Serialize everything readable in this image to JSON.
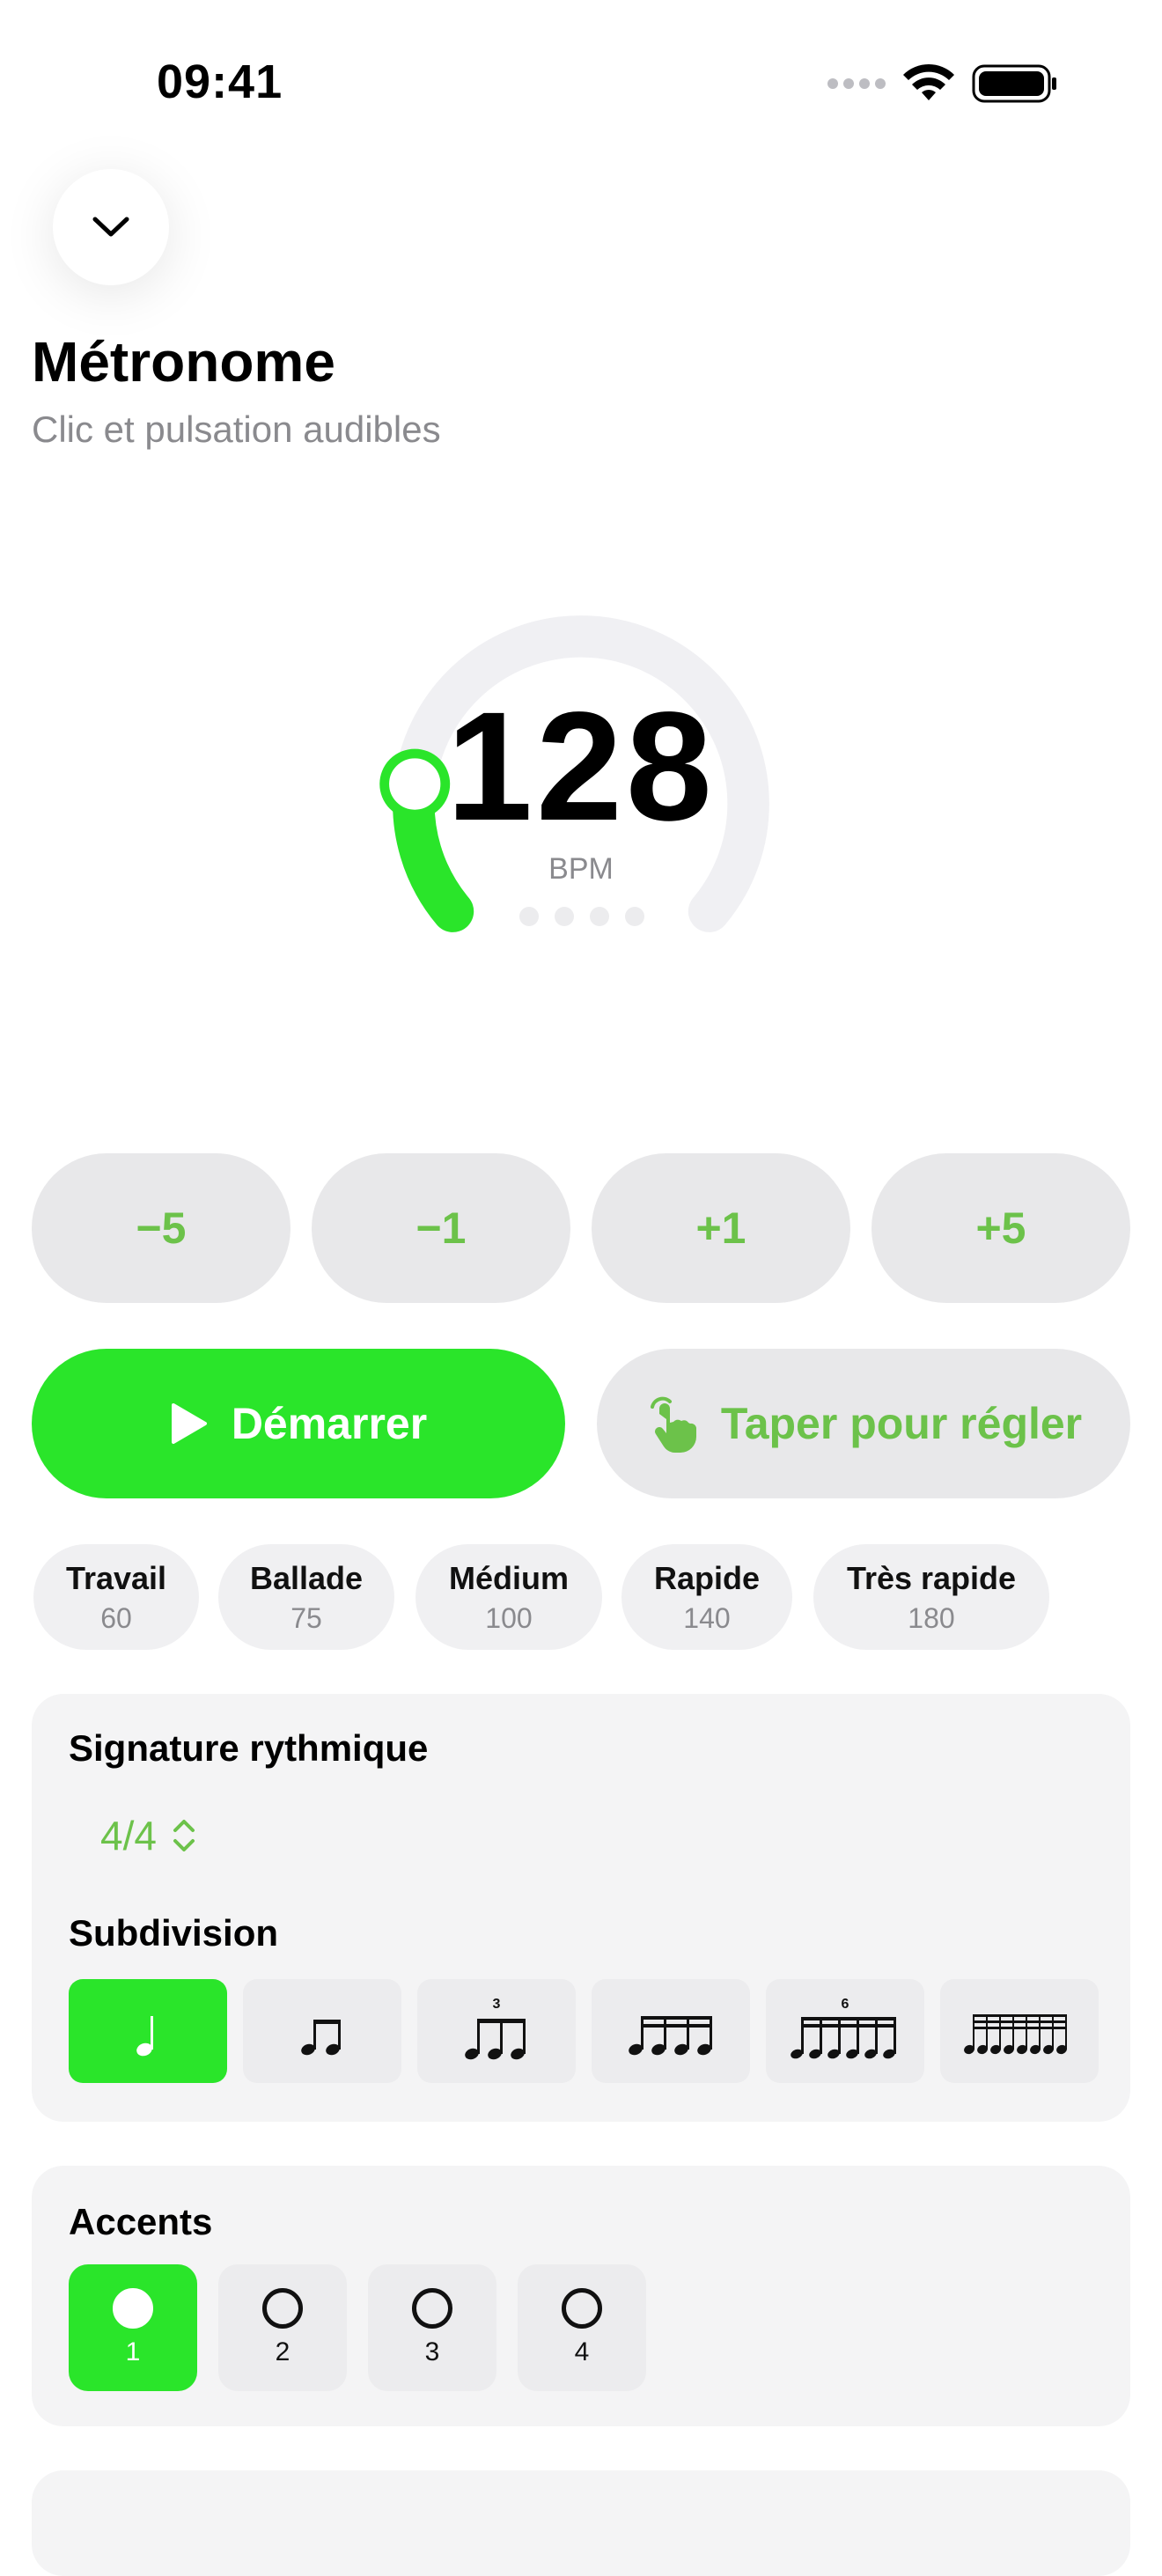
{
  "status_bar": {
    "time": "09:41"
  },
  "header": {
    "title": "Métronome",
    "subtitle": "Clic et pulsation audibles"
  },
  "tempo": {
    "bpm": "128",
    "unit": "BPM",
    "dial_fraction": 0.18
  },
  "steppers": [
    "−5",
    "−1",
    "+1",
    "+5"
  ],
  "actions": {
    "start_label": "Démarrer",
    "tap_label": "Taper pour régler"
  },
  "presets": [
    {
      "name": "Travail",
      "bpm": "60"
    },
    {
      "name": "Ballade",
      "bpm": "75"
    },
    {
      "name": "Médium",
      "bpm": "100"
    },
    {
      "name": "Rapide",
      "bpm": "140"
    },
    {
      "name": "Très rapide",
      "bpm": "180"
    }
  ],
  "rhythm": {
    "signature_title": "Signature rythmique",
    "signature_value": "4/4",
    "subdivision_title": "Subdivision",
    "subdivisions": [
      "quarter-note-icon",
      "eighth-notes-icon",
      "triplet-icon",
      "sixteenth-notes-icon",
      "sextuplet-icon",
      "thirty-second-notes-icon"
    ],
    "triplet_label": "3",
    "sextuplet_label": "6",
    "selected_subdivision": 0
  },
  "accents": {
    "title": "Accents",
    "beats": [
      "1",
      "2",
      "3",
      "4"
    ],
    "selected": 0
  },
  "colors": {
    "accent": "#2ae52a",
    "accent_text": "#6cc24a",
    "track": "#f0f0f3"
  }
}
